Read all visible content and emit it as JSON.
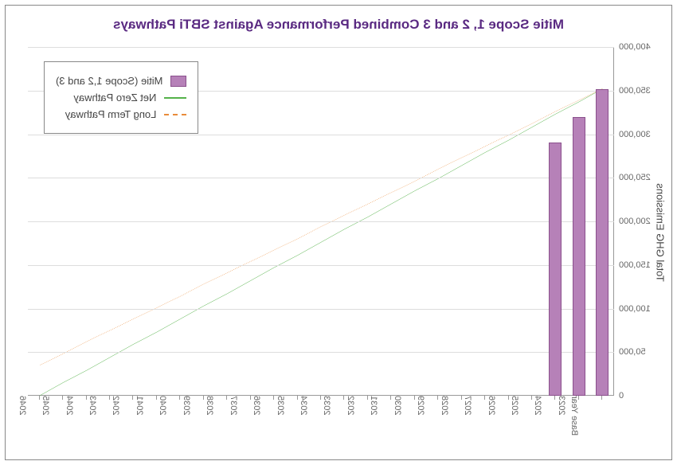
{
  "chart_data": {
    "type": "bar",
    "title": "Mitie Scope 1, 2 and 3 Combined Performance Against SBTi Pathways",
    "xlabel": "",
    "ylabel": "Total GHG Emissions",
    "ylim": [
      0,
      400000
    ],
    "yticks": [
      0,
      50000,
      100000,
      150000,
      200000,
      250000,
      300000,
      350000,
      400000
    ],
    "ytick_labels": [
      "0",
      "50,000",
      "100,000",
      "150,000",
      "200,000",
      "250,000",
      "300,000",
      "350,000",
      "400,000"
    ],
    "categories": [
      "Base Year",
      "2023",
      "2024",
      "2025",
      "2026",
      "2027",
      "2028",
      "2029",
      "2030",
      "2031",
      "2032",
      "2033",
      "2034",
      "2035",
      "2036",
      "2037",
      "2038",
      "2039",
      "2040",
      "2041",
      "2042",
      "2043",
      "2044",
      "2045",
      "2046"
    ],
    "series": [
      {
        "name": "Mitie (Scope 1,2 and 3)",
        "type": "bar",
        "color": "#b681b8",
        "values": [
          352000,
          320000,
          290000,
          null,
          null,
          null,
          null,
          null,
          null,
          null,
          null,
          null,
          null,
          null,
          null,
          null,
          null,
          null,
          null,
          null,
          null,
          null,
          null,
          null,
          null
        ]
      },
      {
        "name": "Net Zero Pathway",
        "type": "line",
        "style": "solid",
        "color": "#55b24a",
        "values": [
          352000,
          337000,
          323000,
          308000,
          293000,
          279000,
          264000,
          249000,
          235000,
          220000,
          205000,
          191000,
          176000,
          161000,
          147000,
          132000,
          117000,
          103000,
          88000,
          73000,
          59000,
          44000,
          29000,
          15000,
          0
        ]
      },
      {
        "name": "Long Term Pathway",
        "type": "line",
        "style": "dashed",
        "color": "#e98b3a",
        "values": [
          352000,
          339000,
          326000,
          312000,
          299000,
          286000,
          273000,
          260000,
          246000,
          233000,
          220000,
          207000,
          194000,
          180000,
          167000,
          154000,
          141000,
          128000,
          114000,
          101000,
          88000,
          75000,
          62000,
          48000,
          35000
        ]
      }
    ],
    "legend": {
      "position": "upper-right",
      "items": [
        "Mitie (Scope 1,2 and 3)",
        "Net Zero Pathway",
        "Long Term Pathway"
      ]
    }
  }
}
